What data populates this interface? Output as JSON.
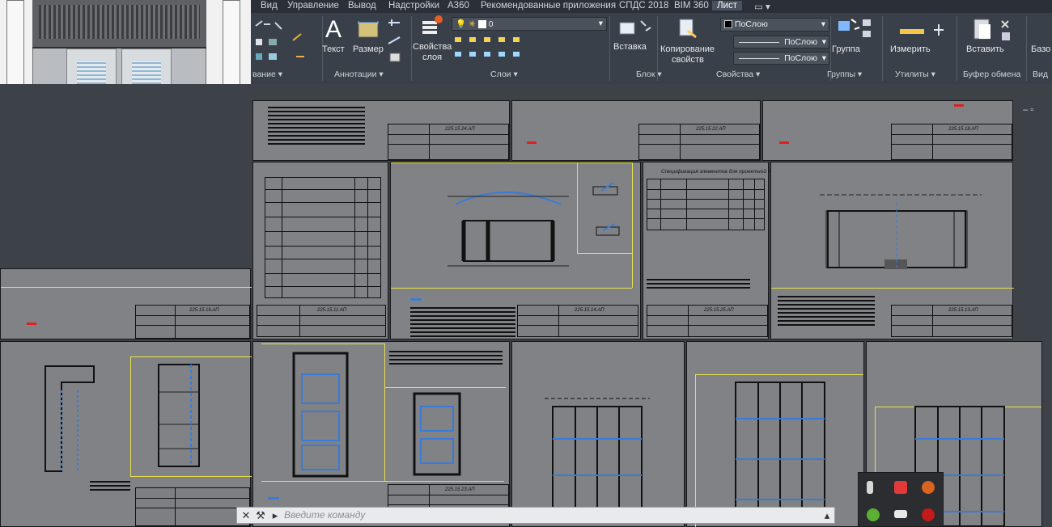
{
  "ribbon": {
    "tabs": [
      {
        "label": "Вид"
      },
      {
        "label": "Управление"
      },
      {
        "label": "Вывод"
      },
      {
        "label": "Надстройки"
      },
      {
        "label": "А360"
      },
      {
        "label": "Рекомендованные приложения"
      },
      {
        "label": "СПДС 2018"
      },
      {
        "label": "BIM 360"
      },
      {
        "label": "Лист"
      }
    ],
    "panel_draw_label": "вание ▾",
    "text_button": "Текст",
    "size_button": "Размер",
    "annotations_label": "Аннотации ▾",
    "layer_props_line1": "Свойства",
    "layer_props_line2": "слоя",
    "layer_value": "0",
    "layers_label": "Слои ▾",
    "insert_button": "Вставка",
    "block_label": "Блок ▾",
    "copy_props_line1": "Копирование",
    "copy_props_line2": "свойств",
    "color_value": "ПоСлою",
    "linetype_value": "ПоСлою",
    "lineweight_value": "ПоСлою",
    "properties_label": "Свойства ▾",
    "group_button": "Группа",
    "groups_label": "Группы ▾",
    "measure_button": "Измерить",
    "utilities_label": "Утилиты ▾",
    "paste_button": "Вставить",
    "clipboard_label": "Буфер обмена",
    "base_button": "Базо",
    "view_label": "Вид"
  },
  "drawing": {
    "sheet_codes": [
      "225.15.24.АП",
      "225.15.22.АП",
      "225.15.18.АП",
      "225.15.16.АП",
      "225.15.13.АП",
      "225.15.11.АП",
      "225.15.14.АП",
      "225.15.25.АП",
      "225.15.23.АП"
    ],
    "schedule_title": "Спецификация элементов для проектной оценки"
  },
  "command_line": {
    "placeholder": "Введите команду"
  },
  "colors": {
    "ribbon_bg": "#3a4049",
    "sheet_bg": "#808286",
    "viewport_border": "#e8e04b",
    "accent_blue": "#3a7bd5",
    "accent_red": "#e02020"
  }
}
